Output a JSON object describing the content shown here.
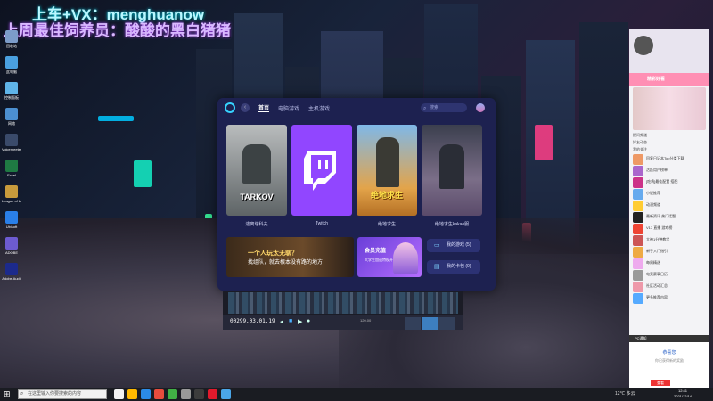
{
  "overlay": {
    "line1": "上车+VX：menghuanow",
    "line2": "上周最佳饲养员：酸酸的黑白猪猪"
  },
  "desktop_icons": [
    {
      "label": "回收站",
      "color": "#7c9cc9"
    },
    {
      "label": "此电脑",
      "color": "#4aa0e0"
    },
    {
      "label": "控制面板",
      "color": "#5fb4e8"
    },
    {
      "label": "网络",
      "color": "#4c8fd1"
    },
    {
      "label": "Voicemeeter",
      "color": "#3a4a6a"
    },
    {
      "label": "Excel",
      "color": "#1f7a43"
    },
    {
      "label": "League of Legends",
      "color": "#c89b3c"
    },
    {
      "label": "Ubisoft",
      "color": "#2a7fe8"
    },
    {
      "label": "ADOBE",
      "color": "#6d5bd0"
    },
    {
      "label": "Adobe Audit",
      "color": "#1c2a8c"
    }
  ],
  "window": {
    "tabs": [
      {
        "label": "首页",
        "active": true
      },
      {
        "label": "电脑游戏",
        "active": false
      },
      {
        "label": "主机游戏",
        "active": false
      }
    ],
    "search_placeholder": "搜索",
    "cards": [
      {
        "name": "逃离塔科夫",
        "cover_text": "TARKOV",
        "bg": "#8b8f90"
      },
      {
        "name": "Twitch",
        "cover_text": "",
        "bg": "#9146ff"
      },
      {
        "name": "绝地求生",
        "cover_text": "绝地求生",
        "bg": "#d79a3e"
      },
      {
        "name": "绝地求生kakao服",
        "cover_text": "",
        "bg": "#5a5f6e"
      }
    ],
    "banner": {
      "line1": "一个人玩太无聊？",
      "line2": "找组队，就去根本没有路的地方"
    },
    "banner2": {
      "line1": "会员充值",
      "line2": "大学生加速特权开放"
    },
    "side_buttons": [
      "我的游戏 (5)",
      "我的卡包 (0)"
    ]
  },
  "editor": {
    "timecode": "00299.03.01.19",
    "zoom": "120.00"
  },
  "right_panel": {
    "pink_title": "精彩好看",
    "lines": [
      "提问频道",
      "好友动态",
      "我的关注"
    ],
    "items": [
      {
        "text": "回复日记本Top分类下载",
        "color": "#e96"
      },
      {
        "text": "活跃用户榜单",
        "color": "#a6c"
      },
      {
        "text": "[吃鸡]最佳配置 搭配",
        "color": "#c38"
      },
      {
        "text": "小说推荐",
        "color": "#6ae"
      },
      {
        "text": "动漫频道",
        "color": "#fc3"
      },
      {
        "text": "最新资讯 热门话题",
        "color": "#222"
      },
      {
        "text": "V17 直播 游戏榜",
        "color": "#e43"
      },
      {
        "text": "大神1分钟教学",
        "color": "#c55"
      },
      {
        "text": "新手入门指引",
        "color": "#ea4"
      },
      {
        "text": "每周精选",
        "color": "#eae"
      },
      {
        "text": "电竞赛事日历",
        "color": "#999"
      },
      {
        "text": "社区活动汇总",
        "color": "#e9a"
      },
      {
        "text": "更多推荐内容",
        "color": "#5af"
      }
    ],
    "bottom": {
      "header": "PC通知",
      "title": "恭喜您",
      "desc": "你已获得新的奖励",
      "button": "查看"
    }
  },
  "taskbar": {
    "search_placeholder": "在这里输入你要搜索的内容",
    "apps": [
      "#f2f2f2",
      "#ffb900",
      "#2b8be6",
      "#e84c3d",
      "#41b045",
      "#999",
      "#3c3c3c",
      "#e21a2c",
      "#4aa6e8"
    ],
    "tray": "12℃ 多云",
    "time": "12:41",
    "date": "2021/12/14"
  }
}
